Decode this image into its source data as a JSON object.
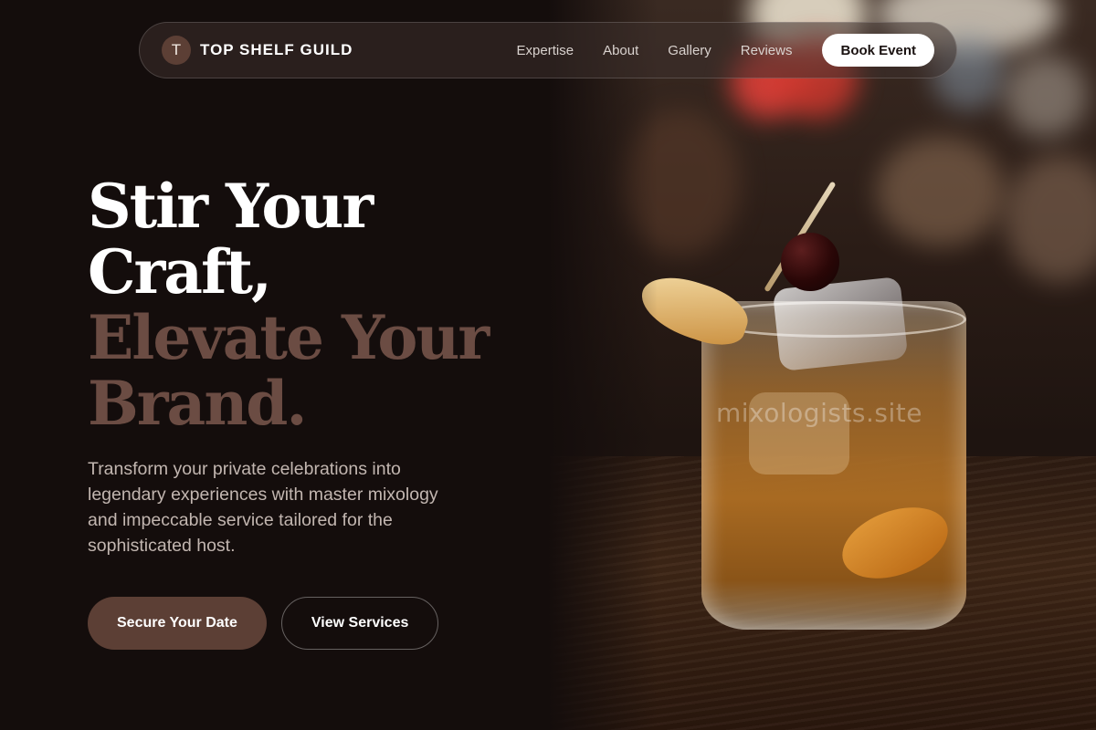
{
  "nav": {
    "brand_initial": "T",
    "brand_name": "TOP SHELF GUILD",
    "links": [
      "Expertise",
      "About",
      "Gallery",
      "Reviews"
    ],
    "cta_label": "Book Event"
  },
  "hero": {
    "headline_line1": "Stir Your",
    "headline_line2": "Craft,",
    "headline_line3": "Elevate Your",
    "headline_line4": "Brand.",
    "subtitle": "Transform your private celebrations into legendary experiences with master mixology and impeccable service tailored for the sophisticated host.",
    "primary_button": "Secure Your Date",
    "secondary_button": "View Services"
  },
  "image": {
    "watermark": "mixologists.site"
  },
  "colors": {
    "background": "#140d0c",
    "accent": "#5c3f35",
    "headline_muted": "#6b4c43",
    "text_muted": "#c2b6b0"
  }
}
